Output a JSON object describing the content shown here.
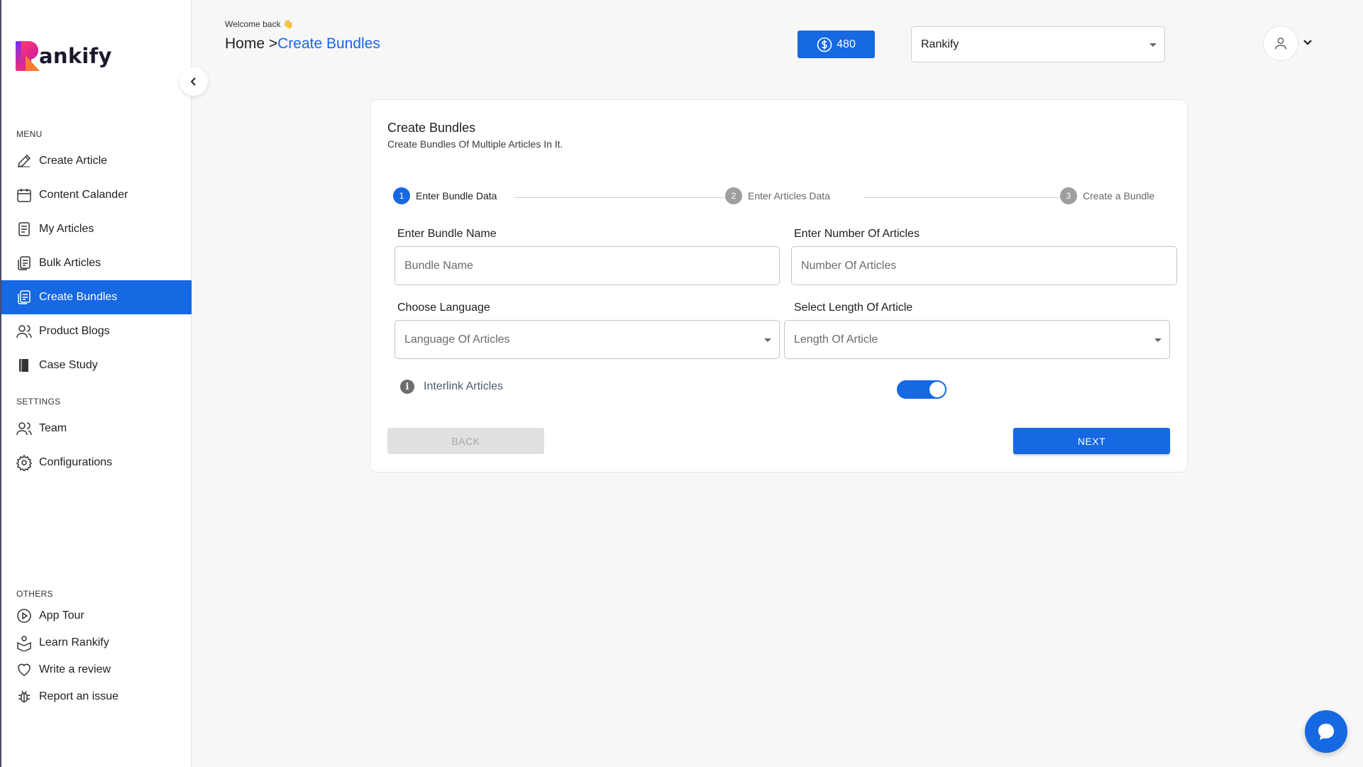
{
  "app": {
    "logo_text": "ankify"
  },
  "sidebar": {
    "menu_label": "MENU",
    "menu_items": [
      {
        "label": "Create Article",
        "icon": "pencil-icon"
      },
      {
        "label": "Content Calander",
        "icon": "calendar-icon"
      },
      {
        "label": "My Articles",
        "icon": "document-icon"
      },
      {
        "label": "Bulk Articles",
        "icon": "documents-icon"
      },
      {
        "label": "Create Bundles",
        "icon": "bundle-icon",
        "active": true
      },
      {
        "label": "Product Blogs",
        "icon": "users-icon"
      },
      {
        "label": "Case Study",
        "icon": "book-icon"
      }
    ],
    "settings_label": "SETTINGS",
    "settings_items": [
      {
        "label": "Team",
        "icon": "users-icon"
      },
      {
        "label": "Configurations",
        "icon": "gear-icon"
      }
    ],
    "others_label": "OTHERS",
    "others_items": [
      {
        "label": "App Tour",
        "icon": "play-circle-icon"
      },
      {
        "label": "Learn Rankify",
        "icon": "learn-icon"
      },
      {
        "label": "Write a review",
        "icon": "heart-icon"
      },
      {
        "label": "Report an issue",
        "icon": "bug-icon"
      }
    ]
  },
  "header": {
    "welcome": "Welcome back 👋",
    "breadcrumb_home": "Home >",
    "breadcrumb_current": "Create Bundles",
    "credits": "480",
    "project_selected": "Rankify"
  },
  "card": {
    "title": "Create Bundles",
    "subtitle": "Create Bundles Of Multiple Articles In It.",
    "steps": [
      {
        "num": "1",
        "label": "Enter Bundle Data"
      },
      {
        "num": "2",
        "label": "Enter Articles Data"
      },
      {
        "num": "3",
        "label": "Create a Bundle"
      }
    ],
    "bundle_name_label": "Enter Bundle Name",
    "bundle_name_placeholder": "Bundle Name",
    "num_articles_label": "Enter Number Of Articles",
    "num_articles_placeholder": "Number Of Articles",
    "language_label": "Choose Language",
    "language_placeholder": "Language Of Articles",
    "length_label": "Select Length Of Article",
    "length_placeholder": "Length Of Article",
    "interlink_label": "Interlink Articles",
    "interlink_on": true,
    "back_label": "BACK",
    "next_label": "NEXT"
  },
  "colors": {
    "accent": "#1668e3",
    "disabled": "#e0e0e0"
  }
}
